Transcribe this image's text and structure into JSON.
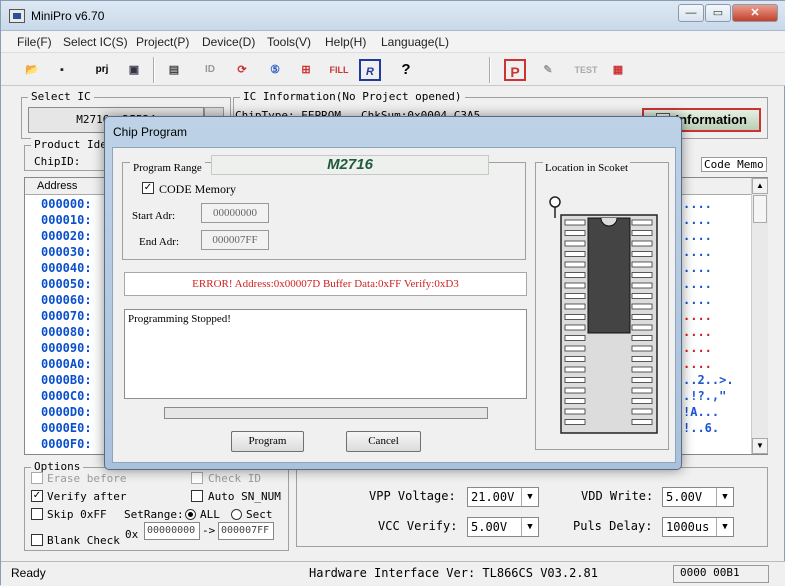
{
  "window": {
    "title": "MiniPro v6.70",
    "min": "—",
    "max": "▭",
    "close": "✕"
  },
  "menu": [
    "File(F)",
    "Select IC(S)",
    "Project(P)",
    "Device(D)",
    "Tools(V)",
    "Help(H)",
    "Language(L)"
  ],
  "toolbar": {
    "prj": "prj",
    "id": "ID",
    "fill": "FILL",
    "r": "R",
    "help": "?",
    "p": "P",
    "test": "TEST"
  },
  "select_ic": {
    "label": "Select IC",
    "value": "M2716 @DIP24"
  },
  "ic_info": {
    "label": "IC Information(No Project opened)",
    "chiptype": "ChipType:  EEPROM",
    "chksum": "ChkSum:0x0004_C3A5"
  },
  "product": {
    "label": "Product Iden",
    "chipid": "ChipID:"
  },
  "information_button": "Information",
  "code_memo": "Code Memo",
  "hex": {
    "header": "Address",
    "addresses": [
      "000000:",
      "000010:",
      "000020:",
      "000030:",
      "000040:",
      "000050:",
      "000060:",
      "000070:",
      "000080:",
      "000090:",
      "0000A0:",
      "0000B0:",
      "0000C0:",
      "0000D0:",
      "0000E0:",
      "0000F0:"
    ],
    "ascii": [
      "....",
      "....",
      "....",
      "....",
      "....",
      "....",
      "....",
      "....",
      "....",
      "....",
      "....",
      "..2..>.",
      ".!?.,\"",
      "!A...",
      "!..6.",
      ""
    ],
    "ascii_colors": [
      "#1a55d6",
      "#1a55d6",
      "#1a55d6",
      "#1a55d6",
      "#1a55d6",
      "#1a55d6",
      "#1a55d6",
      "#d02020",
      "#d02020",
      "#d02020",
      "#d02020",
      "#1a55d6",
      "#1a55d6",
      "#1a55d6",
      "#1a55d6",
      "#1a55d6"
    ]
  },
  "options": {
    "label": "Options",
    "erase": "Erase before",
    "verify": "Verify after",
    "skip": "Skip 0xFF",
    "blank": "Blank Check",
    "checkid": "Check ID",
    "autosn": "Auto SN_NUM",
    "setrange": "SetRange:",
    "all": "ALL",
    "sect": "Sect",
    "prefix": "0x",
    "range_start": "00000000",
    "range_arrow": "->",
    "range_end": "000007FF"
  },
  "voltage": {
    "vpp_label": "VPP Voltage:",
    "vpp": "21.00V",
    "vdd_label": "VDD Write:",
    "vdd": "5.00V",
    "vcc_label": "VCC Verify:",
    "vcc": "5.00V",
    "puls_label": "Puls Delay:",
    "puls": "1000us"
  },
  "status": {
    "left": "Ready",
    "hw": "Hardware Interface Ver: TL866CS V03.2.81",
    "right": "0000 00B1"
  },
  "dialog": {
    "title": "Chip Program",
    "range_label": "Program Range",
    "chip": "M2716",
    "code_memory": "CODE Memory",
    "start_label": "Start Adr:",
    "start": "00000000",
    "end_label": "End Adr:",
    "end": "000007FF",
    "error": "ERROR!  Address:0x00007D   Buffer Data:0xFF   Verify:0xD3",
    "log": "Programming Stopped!",
    "progress": 0,
    "location_label": "Location in Scoket",
    "program_btn": "Program",
    "cancel_btn": "Cancel"
  }
}
